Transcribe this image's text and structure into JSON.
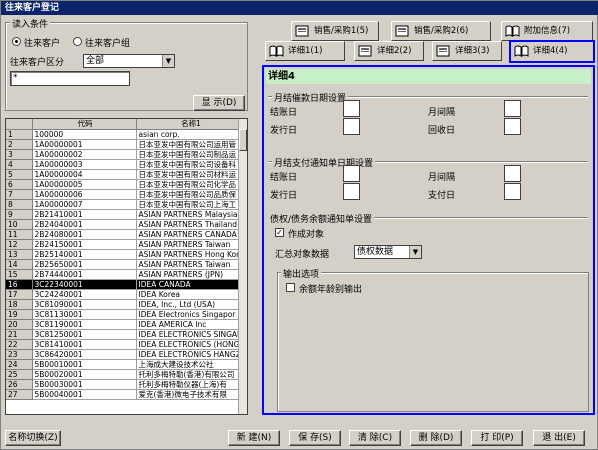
{
  "window": {
    "title": "往来客户登记"
  },
  "filter": {
    "group_title": "读入条件",
    "radio_customer": "往来客户",
    "radio_group": "往来客户组",
    "category_label": "往来客户区分",
    "category_value": "全部",
    "search_value": "*",
    "display_button": "显  示(D)"
  },
  "grid": {
    "col_code": "代码",
    "col_name": "名称1",
    "rows": [
      {
        "n": "1",
        "code": "100000",
        "name": "asian corp."
      },
      {
        "n": "2",
        "code": "1A00000001",
        "name": "日本亚发中国有限公司运用管"
      },
      {
        "n": "3",
        "code": "1A00000002",
        "name": "日本亚发中国有限公司制品运"
      },
      {
        "n": "4",
        "code": "1A00000003",
        "name": "日本亚发中国有限公司设备科"
      },
      {
        "n": "5",
        "code": "1A00000004",
        "name": "日本亚发中国有限公司材料运"
      },
      {
        "n": "6",
        "code": "1A00000005",
        "name": "日本亚发中国有限公司化学品"
      },
      {
        "n": "7",
        "code": "1A00000006",
        "name": "日本亚发中国有限公司品质保"
      },
      {
        "n": "8",
        "code": "1A00000007",
        "name": "日本亚发中国有限公司上海工"
      },
      {
        "n": "9",
        "code": "2B21410001",
        "name": "ASIAN PARTNERS Malaysia"
      },
      {
        "n": "10",
        "code": "2B24040001",
        "name": "ASIAN PARTNERS Thailand"
      },
      {
        "n": "11",
        "code": "2B24080001",
        "name": "ASIAN PARTNERS CANADA"
      },
      {
        "n": "12",
        "code": "2B24150001",
        "name": "ASIAN PARTNERS Taiwan"
      },
      {
        "n": "13",
        "code": "2B25140001",
        "name": "ASIAN PARTNERS Hong Kong"
      },
      {
        "n": "14",
        "code": "2B25650001",
        "name": "ASIAN PARTNERS Taiwan"
      },
      {
        "n": "15",
        "code": "2B74440001",
        "name": "ASIAN PARTNERS (JPN)"
      },
      {
        "n": "16",
        "code": "3C22340001",
        "name": "IDEA CANADA"
      },
      {
        "n": "17",
        "code": "3C24240001",
        "name": "IDEA Korea"
      },
      {
        "n": "18",
        "code": "3C81090001",
        "name": "IDEA, Inc., Ltd (USA)"
      },
      {
        "n": "19",
        "code": "3C81130001",
        "name": "IDEA Electronics Singapor"
      },
      {
        "n": "20",
        "code": "3C81190001",
        "name": "IDEA AMERICA Inc"
      },
      {
        "n": "21",
        "code": "3C81250001",
        "name": "IDEA ELECTRONICS SINGAPOR"
      },
      {
        "n": "22",
        "code": "3C81410001",
        "name": "IDEA ELECTRONICS (HONGKON"
      },
      {
        "n": "23",
        "code": "3C86420001",
        "name": "IDEA ELECTRONICS HANGZHOU"
      },
      {
        "n": "24",
        "code": "5B00010001",
        "name": "上海成大建设技术公社"
      },
      {
        "n": "25",
        "code": "5B00020001",
        "name": "托利多梅特勒(香港)有限公司"
      },
      {
        "n": "26",
        "code": "5B00030001",
        "name": "托利多梅特勒仪器(上海)有"
      },
      {
        "n": "27",
        "code": "5B00040001",
        "name": "爱克(香港)微电子技术有限"
      }
    ]
  },
  "tabs": {
    "row1": [
      "销售/采购1(5)",
      "销售/采购2(6)",
      "附加信息(7)"
    ],
    "row2": [
      "详细1(1)",
      "详细2(2)",
      "详细3(3)",
      "详细4(4)"
    ]
  },
  "detail": {
    "header": "详细4",
    "sec1_title": "月结催款日期设置",
    "sec1_closing": "结账日",
    "sec1_interval": "月间隔",
    "sec1_issue": "发行日",
    "sec1_collect": "回收日",
    "sec2_title": "月结支付通知单日期设置",
    "sec2_closing": "结账日",
    "sec2_interval": "月间隔",
    "sec2_issue": "发行日",
    "sec2_pay": "支付日",
    "sec3_title": "债权/债务余额通知单设置",
    "target_check": "作成对象",
    "target_checked": true,
    "agg_label": "汇总对象数据",
    "agg_value": "债权数据",
    "output_title": "输出选项",
    "yearly_check": "余额年龄别输出"
  },
  "footer": {
    "switch_name": "名称切换(Z)",
    "new": "新  建(N)",
    "save": "保  存(S)",
    "clear": "清  除(C)",
    "delete": "删  除(D)",
    "print": "打  印(P)",
    "exit": "退  出(E)"
  }
}
